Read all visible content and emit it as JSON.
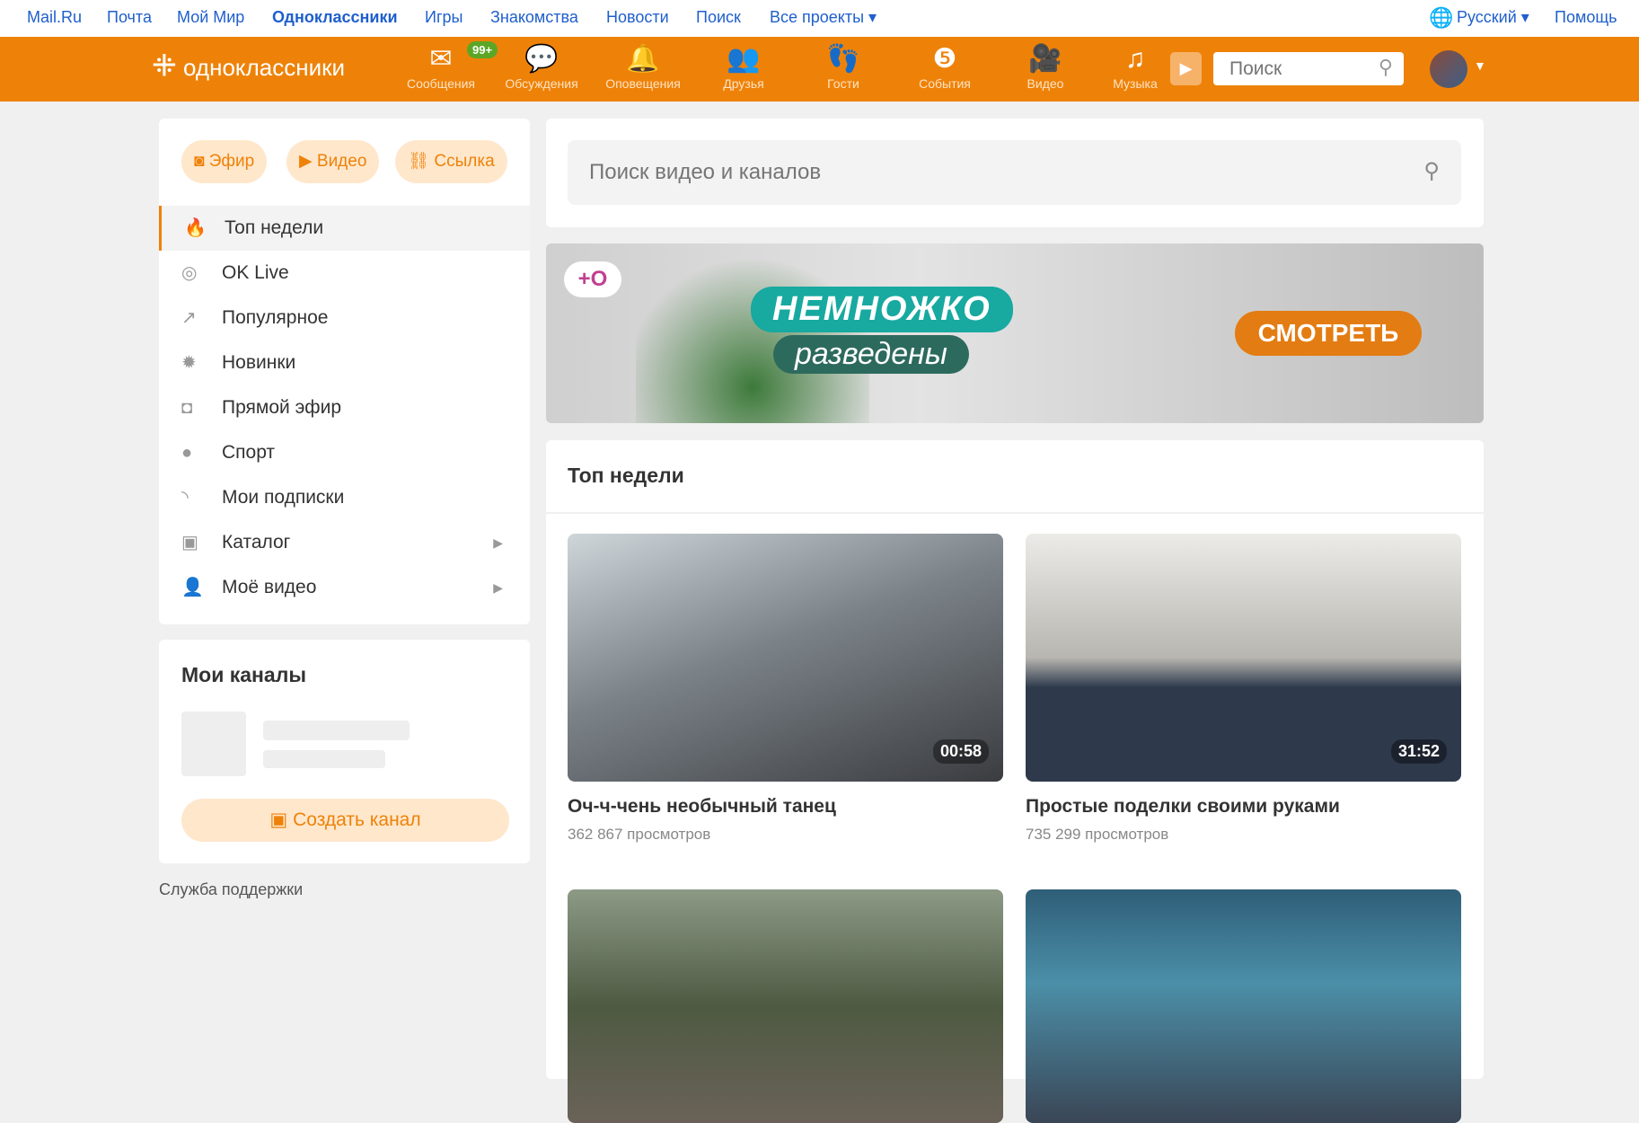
{
  "topbar": {
    "links": [
      "Mail.Ru",
      "Почта",
      "Мой Мир",
      "Одноклассники",
      "Игры",
      "Знакомства",
      "Новости",
      "Поиск",
      "Все проекты ▾"
    ],
    "language": "Русский ▾",
    "help": "Помощь"
  },
  "header": {
    "logo": "одноклассники",
    "nav": [
      {
        "label": "Сообщения",
        "icon": "envelope-icon"
      },
      {
        "label": "Обсуждения",
        "icon": "chat-icon"
      },
      {
        "label": "Оповещения",
        "icon": "bell-icon"
      },
      {
        "label": "Друзья",
        "icon": "friends-icon"
      },
      {
        "label": "Гости",
        "icon": "footprints-icon"
      },
      {
        "label": "События",
        "icon": "events-icon"
      },
      {
        "label": "Видео",
        "icon": "video-camera-icon"
      },
      {
        "label": "Музыка",
        "icon": "music-icon"
      }
    ],
    "messages_badge": "99+",
    "search_placeholder": "Поиск",
    "accent": "#ee8208"
  },
  "sidebar": {
    "actions": [
      "Эфир",
      "Видео",
      "Ссылка"
    ],
    "menu": [
      {
        "label": "Топ недели",
        "icon": "fire-icon",
        "active": true
      },
      {
        "label": "OK Live",
        "icon": "live-icon"
      },
      {
        "label": "Популярное",
        "icon": "trending-icon"
      },
      {
        "label": "Новинки",
        "icon": "new-badge-icon"
      },
      {
        "label": "Прямой эфир",
        "icon": "camera-icon"
      },
      {
        "label": "Спорт",
        "icon": "sport-icon"
      },
      {
        "label": "Мои подписки",
        "icon": "rss-icon"
      },
      {
        "label": "Каталог",
        "icon": "catalog-icon",
        "arrow": true
      },
      {
        "label": "Моё видео",
        "icon": "user-icon",
        "arrow": true
      }
    ],
    "channels_title": "Мои каналы",
    "create_channel": "Создать канал",
    "support": "Служба поддержки"
  },
  "main": {
    "search_placeholder": "Поиск видео и каналов",
    "banner": {
      "title": "НЕМНОЖКО",
      "subtitle": "разведены",
      "button": "СМОТРЕТЬ"
    },
    "section_title": "Топ недели",
    "videos": [
      {
        "title": "Оч-ч-чень необычный танец",
        "views": "362 867 просмотров",
        "duration": "00:58"
      },
      {
        "title": "Простые поделки своими руками",
        "views": "735 299 просмотров",
        "duration": "31:52"
      }
    ]
  }
}
